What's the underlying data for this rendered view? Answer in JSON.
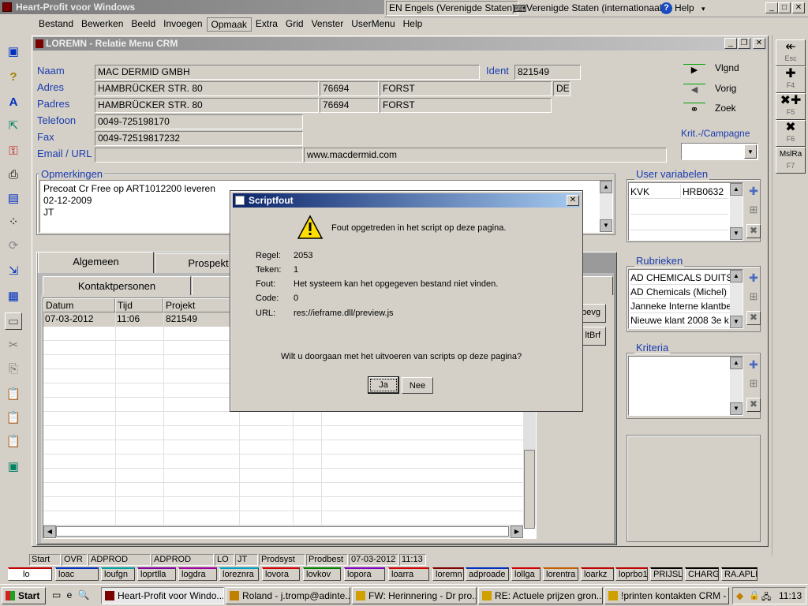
{
  "app": {
    "title": "Heart-Profit voor Windows"
  },
  "langbar": {
    "language": "EN Engels (Verenigde Staten)",
    "keyboard": "Verenigde Staten (internationaal)",
    "help": "Help"
  },
  "menu": [
    "Bestand",
    "Bewerken",
    "Beeld",
    "Invoegen",
    "Opmaak",
    "Extra",
    "Grid",
    "Venster",
    "UserMenu",
    "Help"
  ],
  "child": {
    "title": "LOREMN - Relatie Menu CRM"
  },
  "form": {
    "naam_label": "Naam",
    "naam": "MAC DERMID GMBH",
    "ident_label": "Ident",
    "ident": "821549",
    "adres_label": "Adres",
    "adres": "HAMBRÜCKER STR. 80",
    "adres_pc": "76694",
    "adres_plaats": "FORST",
    "adres_land": "DE",
    "padres_label": "Padres",
    "padres": "HAMBRÜCKER STR. 80",
    "padres_pc": "76694",
    "padres_plaats": "FORST",
    "tel_label": "Telefoon",
    "tel": "0049-725198170",
    "fax_label": "Fax",
    "fax": "0049-72519817232",
    "email_label": "Email / URL",
    "email": "",
    "url": "www.macdermid.com"
  },
  "nav": {
    "next": "Vlgnd",
    "prev": "Vorig",
    "search": "Zoek",
    "krit": "Krit.-/Campagne"
  },
  "opmerkingen": {
    "label": "Opmerkingen",
    "lines": [
      "Precoat Cr Free op ART1012200 leveren",
      "02-12-2009",
      "JT"
    ]
  },
  "uservars": {
    "label": "User variabelen",
    "rows": [
      [
        "KVK",
        "HRB0632"
      ]
    ]
  },
  "rubrieken": {
    "label": "Rubrieken",
    "items": [
      "AD CHEMICALS DUITS",
      "AD Chemicals (Michel)",
      "Janneke Interne klantbe",
      "Nieuwe klant 2008 3e k"
    ]
  },
  "kriteria": {
    "label": "Kriteria"
  },
  "tabs": {
    "main": [
      "Algemeen",
      "Prospekt"
    ],
    "sub": [
      "Kontaktpersonen"
    ]
  },
  "grid": {
    "headers": [
      "Datum",
      "Tijd",
      "Projekt"
    ],
    "rows": [
      [
        "07-03-2012",
        "11:06",
        "821549"
      ]
    ]
  },
  "sidebtns": [
    "bevg",
    "ltBrf"
  ],
  "dialog": {
    "title": "Scriptfout",
    "message": "Fout opgetreden in het script op deze pagina.",
    "regel_label": "Regel:",
    "regel": "2053",
    "teken_label": "Teken:",
    "teken": "1",
    "fout_label": "Fout:",
    "fout": "Het systeem kan het opgegeven bestand niet vinden.",
    "code_label": "Code:",
    "code": "0",
    "url_label": "URL:",
    "url": "res://ieframe.dll/preview.js",
    "question": "Wilt u doorgaan met het uitvoeren van scripts op deze pagina?",
    "yes": "Ja",
    "no": "Nee"
  },
  "righttb": [
    {
      "glyph": "↞",
      "key": "Esc"
    },
    {
      "glyph": "✚",
      "key": "F4"
    },
    {
      "glyph": "✖✚",
      "key": "F5"
    },
    {
      "glyph": "✖",
      "key": "F6"
    },
    {
      "glyph": "MslRa",
      "key": "F7"
    }
  ],
  "statusbar": [
    "Start",
    "OVR",
    "ADPROD",
    "ADPROD",
    "LO",
    "JT",
    "Prodsyst",
    "Prodbest",
    "07-03-2012",
    "11:13"
  ],
  "quickbar": [
    {
      "label": "lo",
      "color": "#c00000"
    },
    {
      "label": "loac",
      "color": "#0030c0"
    },
    {
      "label": "loufgn",
      "color": "#00a0a0"
    },
    {
      "label": "loprtlla",
      "color": "#8000a0"
    },
    {
      "label": "logdra",
      "color": "#a000a0"
    },
    {
      "label": "loreznra",
      "color": "#00a0c0"
    },
    {
      "label": "lovora",
      "color": "#d00000"
    },
    {
      "label": "lovkov",
      "color": "#008000"
    },
    {
      "label": "lopora",
      "color": "#8000c0"
    },
    {
      "label": "loarra",
      "color": "#d00000"
    },
    {
      "label": "loremn",
      "color": "#800000"
    },
    {
      "label": "adproade",
      "color": "#0030c0"
    },
    {
      "label": "lollga",
      "color": "#d00000"
    },
    {
      "label": "lorentra",
      "color": "#c06000"
    },
    {
      "label": "loarkz",
      "color": "#c00000"
    },
    {
      "label": "loprbo1",
      "color": "#c00000"
    },
    {
      "label": "PRIJSLIJ",
      "color": "#000000"
    },
    {
      "label": "CHARGE",
      "color": "#000000"
    },
    {
      "label": "RA.APLIJ",
      "color": "#000000"
    }
  ],
  "taskbar": {
    "start": "Start",
    "tasks": [
      "Heart-Profit voor Windo...",
      "Roland - j.tromp@adinte...",
      "FW: Herinnering - Dr pro...",
      "RE: Actuele prijzen gron...",
      "!printen kontakten CRM - ..."
    ],
    "clock": "11:13"
  }
}
